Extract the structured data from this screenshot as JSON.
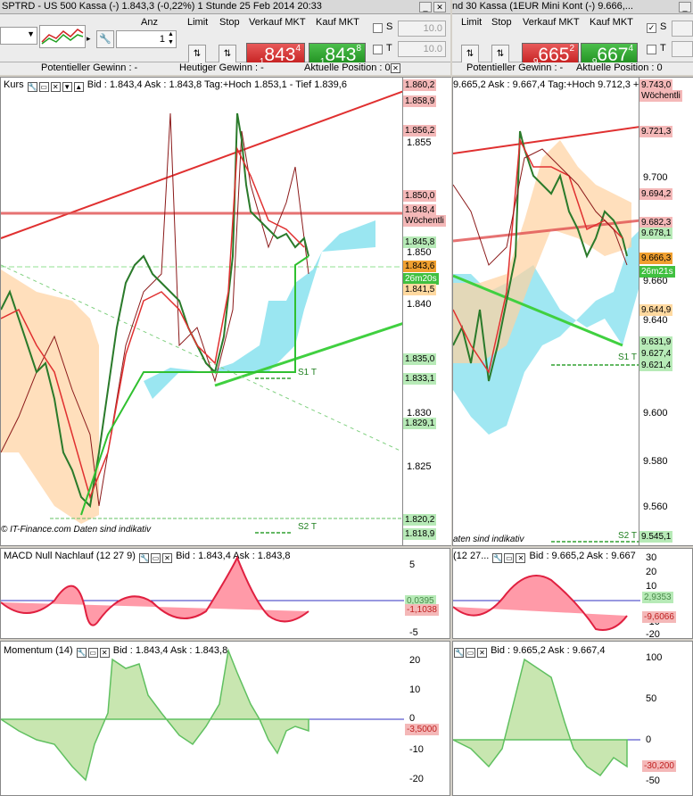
{
  "left_window": {
    "title": "SPTRD - US 500 Kassa (-)    1.843,3 (-0,22%)    1 Stunde  25 Feb 2014 20:33",
    "toolbar": {
      "anz_label": "Anz",
      "limit_label": "Limit",
      "stop_label": "Stop",
      "sell_label": "Verkauf MKT",
      "buy_label": "Kauf MKT",
      "qty": "1",
      "sell_lead": "1",
      "sell_main": "843",
      "sell_small": "4",
      "buy_lead": "1",
      "buy_main": "843",
      "buy_small": "8",
      "s_label": "S",
      "t_label": "T",
      "s_value": "10.0",
      "t_value": "10.0"
    },
    "info": {
      "pot": "Potentieller Gewinn : -",
      "today": "Heutiger Gewinn : -",
      "pos": "Aktuelle Position : 0"
    },
    "main_header": "Kurs",
    "main_quote": "Bid : 1.843,4 Ask : 1.843,8 Tag:+Hoch 1.853,1 - Tief 1.839,6",
    "axis_ticks": [
      "1.855",
      "1.850",
      "1.845",
      "1.840",
      "1.835",
      "1.830",
      "1.825",
      "1.820"
    ],
    "price_labels": [
      {
        "text": "1.860,2",
        "color": "#f4b8b8"
      },
      {
        "text": "1.858,9",
        "color": "#f4b8b8"
      },
      {
        "text": "1.856,2",
        "color": "#f4b8b8"
      },
      {
        "text": "1.850,0",
        "color": "#f4b8b8"
      },
      {
        "text": "1.848,4",
        "color": "#f4b8b8"
      },
      {
        "text": "Wöchentli",
        "color": "#f4b8b8"
      },
      {
        "text": "1.845,8",
        "color": "#b7eab7"
      },
      {
        "text": "1.843,6",
        "color": "#f0a030"
      },
      {
        "text": "26m20s",
        "color": "#40c040"
      },
      {
        "text": "1.841,5",
        "color": "#ffd9a0"
      },
      {
        "text": "1.835,0",
        "color": "#b7eab7"
      },
      {
        "text": "1.833,1",
        "color": "#b7eab7"
      },
      {
        "text": "1.829,1",
        "color": "#b7eab7"
      },
      {
        "text": "1.820,2",
        "color": "#b7eab7"
      },
      {
        "text": "1.818,9",
        "color": "#b7eab7"
      }
    ],
    "s1": "S1 T",
    "s2": "S2 T",
    "footer": "© IT-Finance.com   Daten sind indikativ",
    "macd_header": "MACD Null Nachlauf (12 27 9)",
    "macd_quote": "Bid : 1.843,4 Ask : 1.843,8",
    "macd_ticks": [
      "5",
      "0",
      "-5"
    ],
    "macd_labels": [
      "0,0395",
      "-1,1038"
    ],
    "mom_header": "Momentum (14)",
    "mom_quote": "Bid : 1.843,4 Ask : 1.843,8",
    "mom_ticks": [
      "20",
      "10",
      "0",
      "-10",
      "-20"
    ],
    "mom_label": "-3,5000"
  },
  "right_window": {
    "title": "nd 30 Kassa (1EUR Mini Kont (-)    9.666,...",
    "toolbar": {
      "limit_label": "Limit",
      "stop_label": "Stop",
      "sell_label": "Verkauf MKT",
      "buy_label": "Kauf MKT",
      "sell_lead": "9",
      "sell_main": "665",
      "sell_small": "2",
      "buy_lead": "9",
      "buy_main": "667",
      "buy_small": "4"
    },
    "info": {
      "pot": "Potentieller Gewinn : -",
      "today": "Heutiger Gewinn : -",
      "pos": "Aktuelle Position : 0"
    },
    "main_quote": "9.665,2 Ask : 9.667,4 Tag:+Hoch 9.712,3 +T",
    "axis_ticks": [
      "9.700",
      "9.660",
      "9.640",
      "9.600",
      "9.580",
      "9.560"
    ],
    "price_labels": [
      {
        "text": "9.743,0",
        "color": "#f4b8b8"
      },
      {
        "text": "Wöchentli",
        "color": "#f4b8b8"
      },
      {
        "text": "9.721,3",
        "color": "#f4b8b8"
      },
      {
        "text": "9.694,2",
        "color": "#f4b8b8"
      },
      {
        "text": "9.682,3",
        "color": "#f4b8b8"
      },
      {
        "text": "9.678,1",
        "color": "#b7eab7"
      },
      {
        "text": "9.666,3",
        "color": "#f0a030"
      },
      {
        "text": "26m21s",
        "color": "#40c040"
      },
      {
        "text": "9.644,9",
        "color": "#ffd9a0"
      },
      {
        "text": "9.631,9",
        "color": "#b7eab7"
      },
      {
        "text": "9.627,4",
        "color": "#b7eab7"
      },
      {
        "text": "9.621,4",
        "color": "#b7eab7"
      },
      {
        "text": "9.545,1",
        "color": "#b7eab7"
      }
    ],
    "s1": "S1 T",
    "s2": "S2 T",
    "footer": "aten sind indikativ",
    "macd_header": "(12 27...",
    "macd_quote": "Bid : 9.665,2 Ask : 9.667",
    "macd_ticks": [
      "30",
      "20",
      "10",
      "0",
      "-10",
      "-20"
    ],
    "macd_labels": [
      "2,9353",
      "-9,6066"
    ],
    "mom_quote": "Bid : 9.665,2 Ask : 9.667,4",
    "mom_ticks": [
      "100",
      "50",
      "0",
      "-50"
    ],
    "mom_label": "-30,200"
  }
}
